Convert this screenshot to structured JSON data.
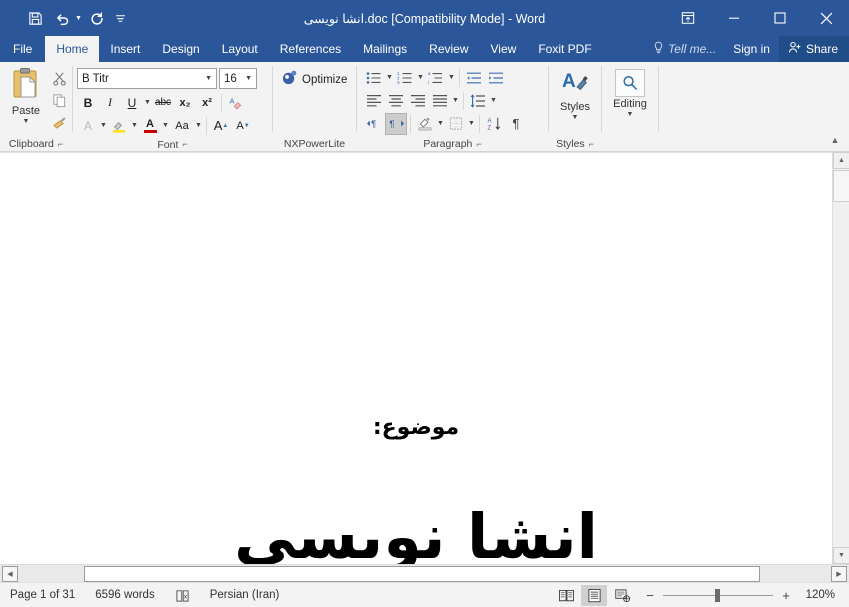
{
  "window": {
    "title": "انشا نویسی.doc [Compatibility Mode] - Word",
    "accent_color": "#2b579a",
    "share_bg": "#204d87"
  },
  "quick_access": {
    "items": [
      {
        "name": "save",
        "icon": "save-icon"
      },
      {
        "name": "undo",
        "icon": "undo-icon"
      },
      {
        "name": "redo",
        "icon": "redo-icon"
      },
      {
        "name": "customize",
        "icon": "customize-quick-access-icon"
      }
    ]
  },
  "window_buttons": {
    "ribbon_display_options": "ribbon-display-options-icon",
    "minimize": "minimize-icon",
    "restore": "restore-icon",
    "close": "close-icon"
  },
  "tabs": [
    {
      "label": "File",
      "active": false
    },
    {
      "label": "Home",
      "active": true
    },
    {
      "label": "Insert",
      "active": false
    },
    {
      "label": "Design",
      "active": false
    },
    {
      "label": "Layout",
      "active": false
    },
    {
      "label": "References",
      "active": false
    },
    {
      "label": "Mailings",
      "active": false
    },
    {
      "label": "Review",
      "active": false
    },
    {
      "label": "View",
      "active": false
    },
    {
      "label": "Foxit PDF",
      "active": false
    }
  ],
  "tab_right": {
    "tell_me": "Tell me...",
    "sign_in": "Sign in",
    "share": "Share"
  },
  "ribbon": {
    "groups": [
      {
        "label": "Clipboard",
        "has_launcher": true
      },
      {
        "label": "Font",
        "has_launcher": true
      },
      {
        "label": "NXPowerLite",
        "has_launcher": false
      },
      {
        "label": "Paragraph",
        "has_launcher": true
      },
      {
        "label": "Styles",
        "has_launcher": true
      },
      {
        "label": "",
        "has_launcher": false
      }
    ],
    "clipboard": {
      "paste_label": "Paste",
      "cut": "cut-icon",
      "copy": "copy-icon",
      "format_painter": "format-painter-icon"
    },
    "font": {
      "font_name": "B Titr",
      "font_size": "16",
      "bold": "B",
      "italic": "I",
      "underline": "U",
      "strikethrough": "abc",
      "subscript": "x₂",
      "superscript": "x²",
      "clear_formatting": "clear-formatting-icon",
      "text_effects": "A",
      "highlight": "highlight-icon",
      "font_color": "A",
      "change_case": "Aa",
      "grow_font": "A",
      "shrink_font": "A"
    },
    "nxpowerlite": {
      "optimize_label": "Optimize"
    },
    "paragraph": {
      "bullets": "bullets-icon",
      "numbering": "numbering-icon",
      "multilevel": "multilevel-list-icon",
      "decrease_indent": "decrease-indent-icon",
      "increase_indent": "increase-indent-icon",
      "align_left": "align-left-icon",
      "align_center": "align-center-icon",
      "align_right": "align-right-icon",
      "justify": "justify-icon",
      "line_spacing": "line-spacing-icon",
      "ltr_text": "ltr-text-direction-icon",
      "rtl_text": "rtl-text-direction-icon",
      "rtl_active": true,
      "shading": "shading-icon",
      "borders": "borders-icon",
      "sort": "sort-icon",
      "show_marks": "show-formatting-marks-icon"
    },
    "styles": {
      "label": "Styles"
    },
    "editing": {
      "label": "Editing"
    },
    "collapse": "collapse-ribbon-icon"
  },
  "document": {
    "subject_line": "موضوع:",
    "title_line": "انشا نویسی"
  },
  "scrollbars": {
    "v_up": "scroll-up-icon",
    "v_down": "scroll-down-icon",
    "h_left": "scroll-left-icon",
    "h_right": "scroll-right-icon"
  },
  "status_bar": {
    "page": "Page 1 of 31",
    "words": "6596 words",
    "proofing_icon": "proofing-errors-icon",
    "language": "Persian (Iran)",
    "views": [
      {
        "name": "read-mode",
        "icon": "read-mode-icon",
        "active": false
      },
      {
        "name": "print-layout",
        "icon": "print-layout-icon",
        "active": true
      },
      {
        "name": "web-layout",
        "icon": "web-layout-icon",
        "active": false
      }
    ],
    "zoom_out": "−",
    "zoom_in": "+",
    "zoom_level": "120%"
  }
}
